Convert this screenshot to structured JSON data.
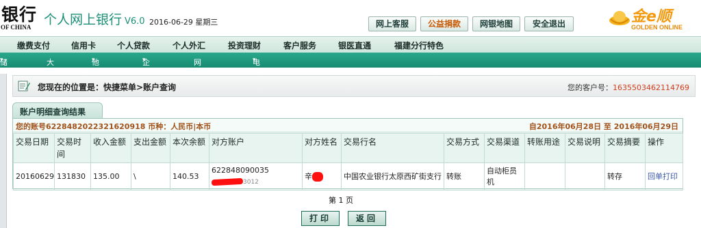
{
  "header": {
    "bank_name_cn": "银行",
    "bank_name_en": "OF CHINA",
    "site_title": "个人网上银行",
    "version": "V6.0",
    "date": "2016-06-29 星期三",
    "buttons": [
      "网上客服",
      "公益捐款",
      "网银地图",
      "安全退出"
    ],
    "logo_cn": "金e顺",
    "logo_en": "GOLDEN ONLINE"
  },
  "nav_main": [
    "缴费支付",
    "信用卡",
    "个人贷款",
    "个人外汇",
    "投资理财",
    "客户服务",
    "银医直通",
    "福建分行特色"
  ],
  "nav_sub": [
    "储蓄业务",
    "大额存单",
    "他行账户",
    "企业服务",
    "网银交易查询",
    "电子回单"
  ],
  "location": {
    "text": "您现在的位置是：快捷菜单>账户查询",
    "customer_label": "您的客户号：",
    "customer_no": "1635503462114769"
  },
  "tab_label": "账户明细查询结果",
  "account": {
    "left": "您的账号6228482022321620918 币种：人民币|本币",
    "right": "自2016年06月28日  至  2016年06月29日"
  },
  "table": {
    "headers": [
      "交易日期",
      "交易时间",
      "收入金额",
      "支出金额",
      "本次余额",
      "对方账户",
      "对方姓名",
      "交易行名",
      "交易方式",
      "交易渠道",
      "转账用途",
      "交易说明",
      "交易摘要",
      "操作"
    ],
    "row": {
      "date": "20160629",
      "time": "131830",
      "income": "135.00",
      "expense": "\\",
      "balance": "140.53",
      "counter_account_prefix": "622848090035",
      "counter_account_suffix": "3012",
      "counter_name": "辛",
      "bank_name": "中国农业银行太原西矿街支行",
      "method": "转账",
      "channel": "自动柜员机",
      "purpose": "",
      "note": "",
      "summary": "转存",
      "action": "回单打印"
    }
  },
  "pager": "第 1 页",
  "footer_buttons": [
    "打印",
    "返回"
  ]
}
